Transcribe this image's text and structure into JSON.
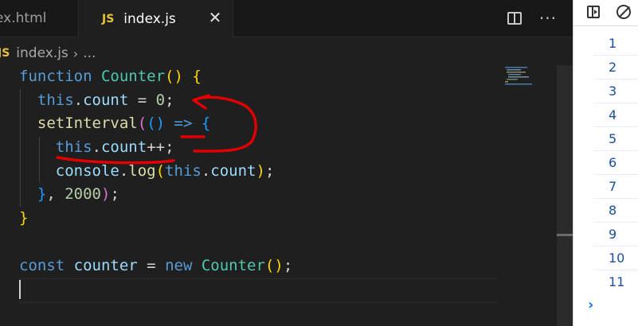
{
  "tabs": [
    {
      "label": "ex.html"
    },
    {
      "badge": "JS",
      "label": "index.js",
      "close": "✕"
    }
  ],
  "actions": {
    "more": "···"
  },
  "breadcrumb": {
    "badge": "JS",
    "file": "index.js",
    "sep": "›",
    "rest": "..."
  },
  "code": {
    "l1": {
      "kw": "function",
      "name": "Counter",
      "open": "(",
      "close": ")",
      "brace": "{"
    },
    "l2": {
      "this": "this",
      "dot": ".",
      "prop": "count",
      "op": " = ",
      "num": "0",
      "semi": ";"
    },
    "l3": {
      "fn": "setInterval",
      "p1": "(",
      "p2": "(",
      "p2c": ")",
      "arrow": " => ",
      "brace": "{"
    },
    "l4": {
      "this": "this",
      "dot": ".",
      "prop": "count",
      "op": "++;"
    },
    "l5": {
      "obj": "console",
      "dot": ".",
      "fn": "log",
      "p": "(",
      "this": "this",
      "dot2": ".",
      "prop": "count",
      "pc": ")",
      "semi": ";"
    },
    "l6": {
      "brace": "}",
      "comma": ", ",
      "num": "2000",
      "pc": ")",
      "semi": ";"
    },
    "l7": {
      "brace": "}"
    },
    "l9": {
      "kw": "const",
      "var": "counter",
      "op": " = ",
      "kw2": "new",
      "cls": "Counter",
      "p": "(",
      "pc": ")",
      "semi": ";"
    }
  },
  "console": {
    "rows": [
      "1",
      "2",
      "3",
      "4",
      "5",
      "6",
      "7",
      "8",
      "9",
      "10",
      "11"
    ],
    "prompt": "›"
  },
  "colors": {
    "annotation": "#e00000",
    "editor_bg": "#1f1f1f"
  }
}
